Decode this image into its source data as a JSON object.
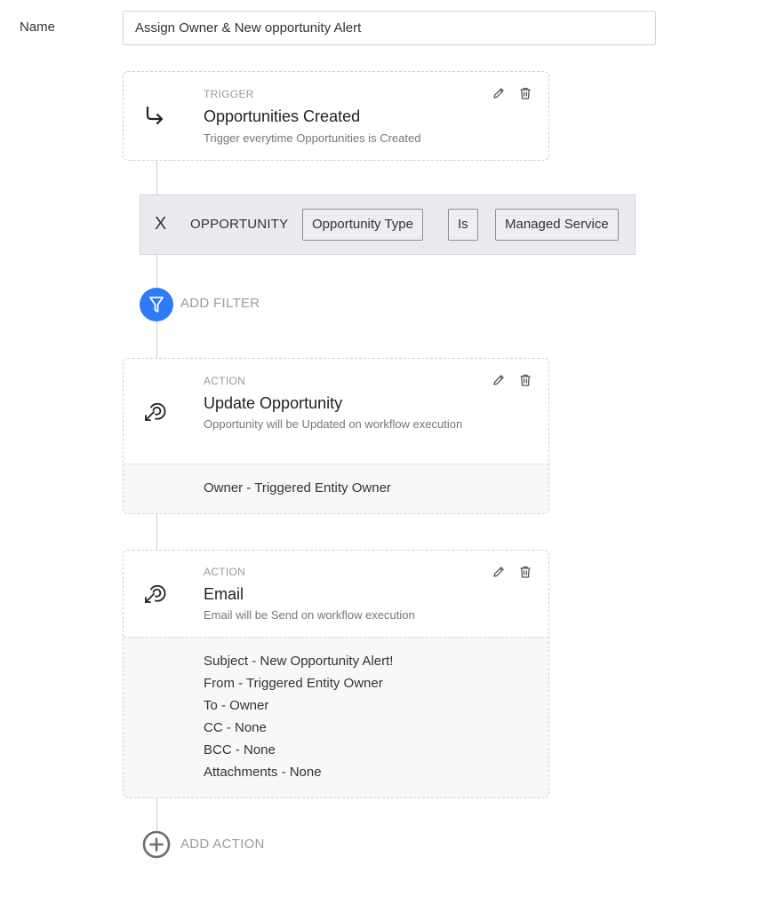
{
  "form": {
    "name_label": "Name",
    "name_value": "Assign Owner & New opportunity Alert"
  },
  "trigger": {
    "kind": "TRIGGER",
    "title": "Opportunities Created",
    "description": "Trigger everytime Opportunities is Created",
    "icon": "arrow-turn-right-icon"
  },
  "filter": {
    "remove": "X",
    "entity": "OPPORTUNITY",
    "field": "Opportunity Type",
    "operator": "Is",
    "value": "Managed Service"
  },
  "add_filter": {
    "label": "ADD FILTER",
    "icon": "funnel-icon",
    "color": "#2f7bf5"
  },
  "actions": [
    {
      "kind": "ACTION",
      "title": "Update Opportunity",
      "description": "Opportunity will be Updated on workflow execution",
      "icon": "action-icon",
      "details": [
        "Owner - Triggered Entity Owner"
      ]
    },
    {
      "kind": "ACTION",
      "title": "Email",
      "description": "Email will be Send on workflow execution",
      "icon": "action-icon",
      "details": [
        "Subject - New Opportunity Alert!",
        "From - Triggered Entity Owner",
        "To - Owner",
        "CC - None",
        "BCC - None",
        "Attachments - None"
      ]
    }
  ],
  "add_action": {
    "label": "ADD ACTION",
    "icon": "plus-circle-icon"
  }
}
